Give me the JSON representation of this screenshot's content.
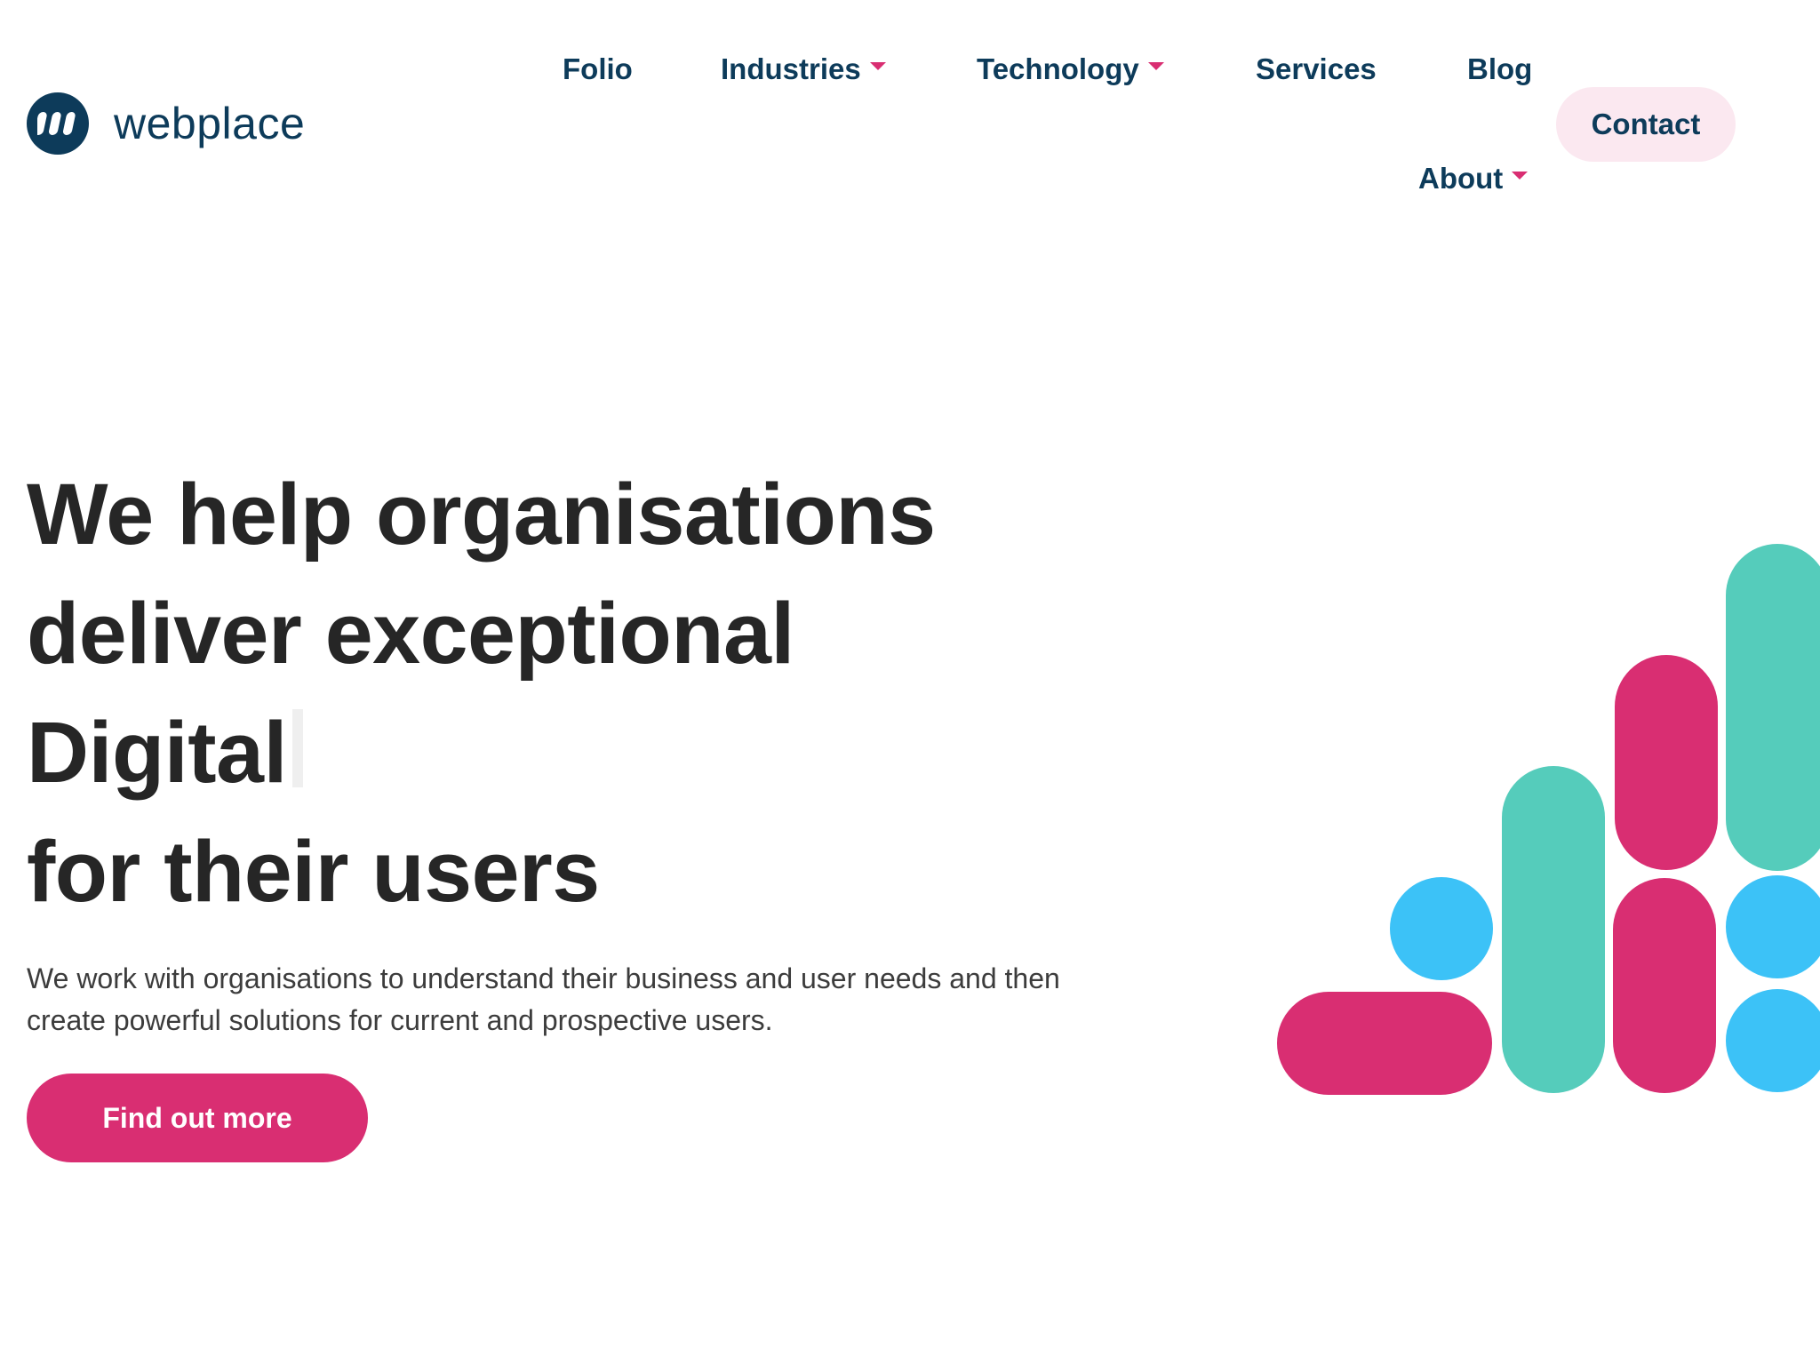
{
  "brand": {
    "name": "webplace",
    "logo_icon": "webplace-logo-icon",
    "colors": {
      "navy": "#0d3b5a",
      "pink": "#d92e72",
      "teal": "#55ccbb",
      "sky": "#3cc2f7",
      "contact_bg": "#fbe8f0"
    }
  },
  "nav": {
    "items": [
      {
        "label": "Folio",
        "has_dropdown": false
      },
      {
        "label": "Industries",
        "has_dropdown": true
      },
      {
        "label": "Technology",
        "has_dropdown": true
      },
      {
        "label": "Services",
        "has_dropdown": false
      },
      {
        "label": "Blog",
        "has_dropdown": false
      },
      {
        "label": "About",
        "has_dropdown": true
      }
    ],
    "contact_label": "Contact"
  },
  "hero": {
    "title_lines": [
      "We help organisations",
      "deliver exceptional",
      "Digital",
      "for their users"
    ],
    "description": "We work with organisations to understand their business and user needs and then create powerful solutions for current and prospective users.",
    "cta_label": "Find out more"
  }
}
